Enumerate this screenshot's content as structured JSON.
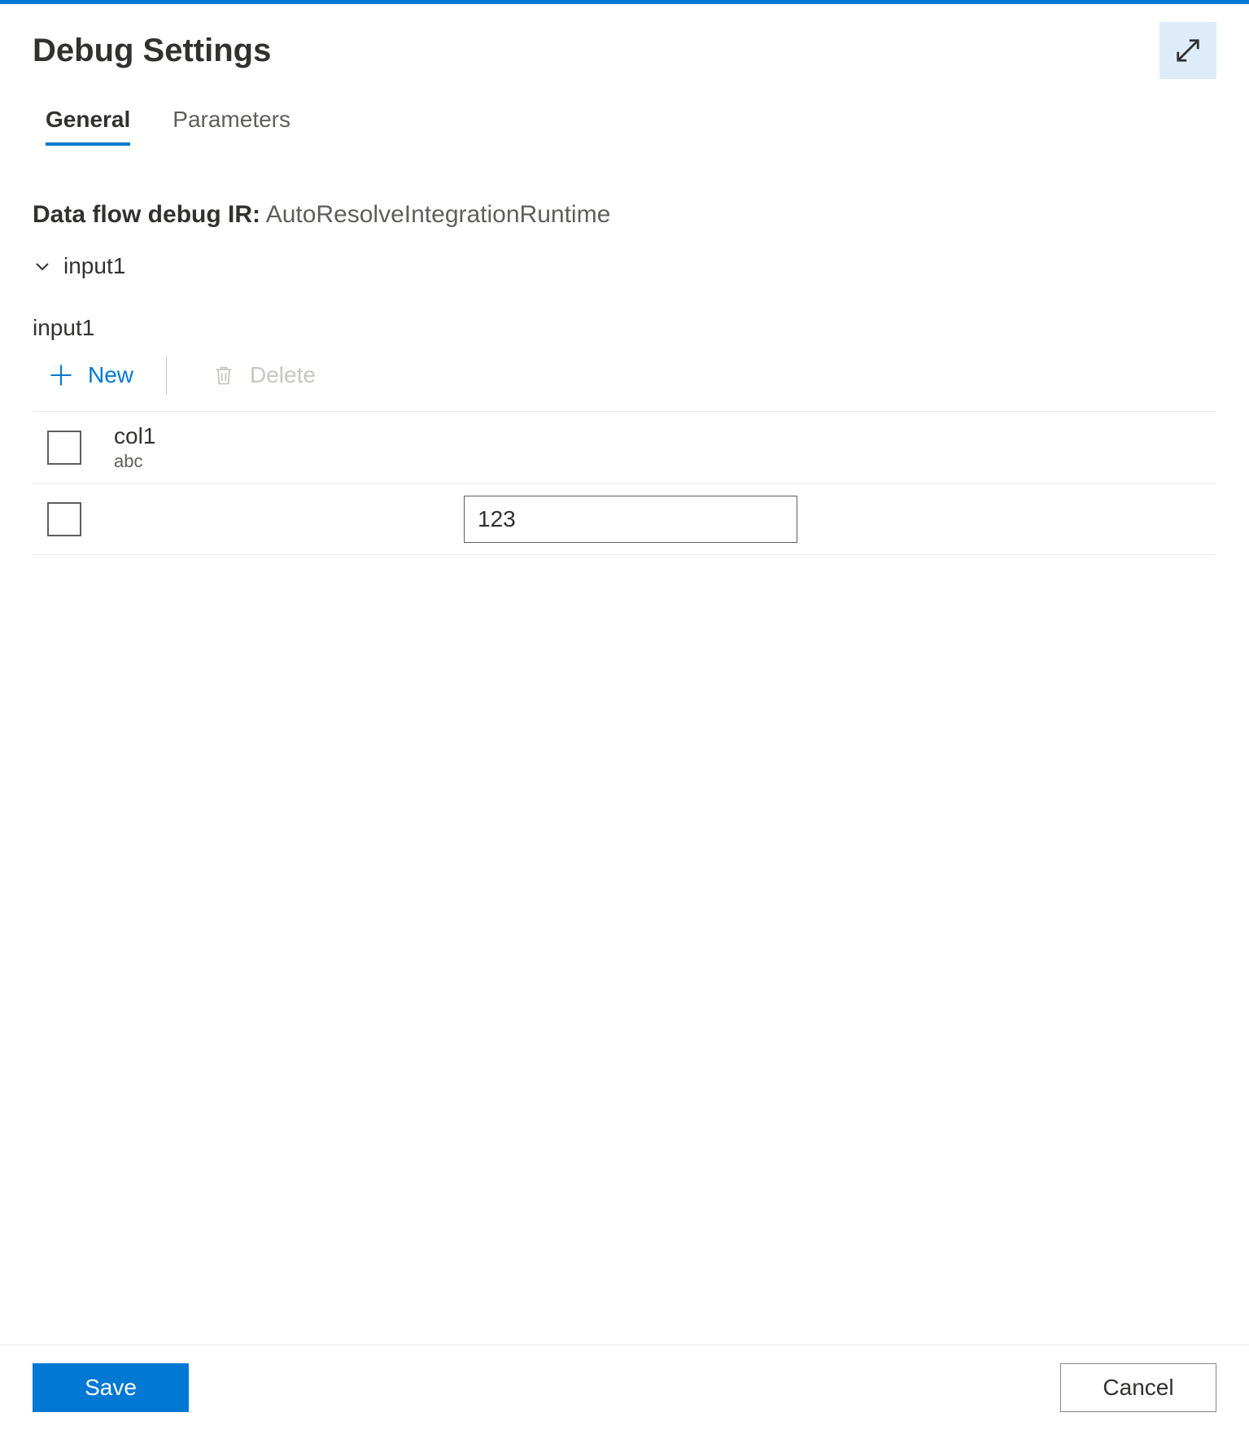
{
  "header": {
    "title": "Debug Settings"
  },
  "tabs": [
    {
      "label": "General",
      "active": true
    },
    {
      "label": "Parameters",
      "active": false
    }
  ],
  "ir": {
    "label": "Data flow debug IR:",
    "value": "AutoResolveIntegrationRuntime"
  },
  "expander": {
    "label": "input1"
  },
  "section": {
    "name": "input1"
  },
  "toolbar": {
    "new_label": "New",
    "delete_label": "Delete"
  },
  "table": {
    "header": {
      "col_name": "col1",
      "col_type": "abc"
    },
    "rows": [
      {
        "value": "123"
      }
    ]
  },
  "footer": {
    "save_label": "Save",
    "cancel_label": "Cancel"
  }
}
